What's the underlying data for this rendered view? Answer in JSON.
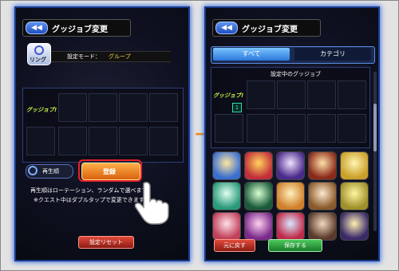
{
  "left_panel": {
    "title": "グッジョブ変更",
    "back_label": "◀◀",
    "ring_label": "リング",
    "mode_text": "設定モード：",
    "mode_value": "グループ",
    "gj_tag": "グッジョブ!",
    "replay_label": "再生順",
    "register_label": "登録",
    "info_line1": "再生順はローテーション、ランダムで選べます",
    "info_line2": "※クエスト中はダブルタップで変更できます",
    "reset_label": "設定リセット"
  },
  "right_panel": {
    "title": "グッジョブ変更",
    "back_label": "◀◀",
    "tabs": [
      "すべて",
      "カテゴリ"
    ],
    "section_title": "設定中のグッジョブ",
    "gj_tag": "グッジョブ!",
    "gj_count": "1",
    "undo_label": "元に戻す",
    "save_label": "保存する"
  },
  "arrow": "→"
}
